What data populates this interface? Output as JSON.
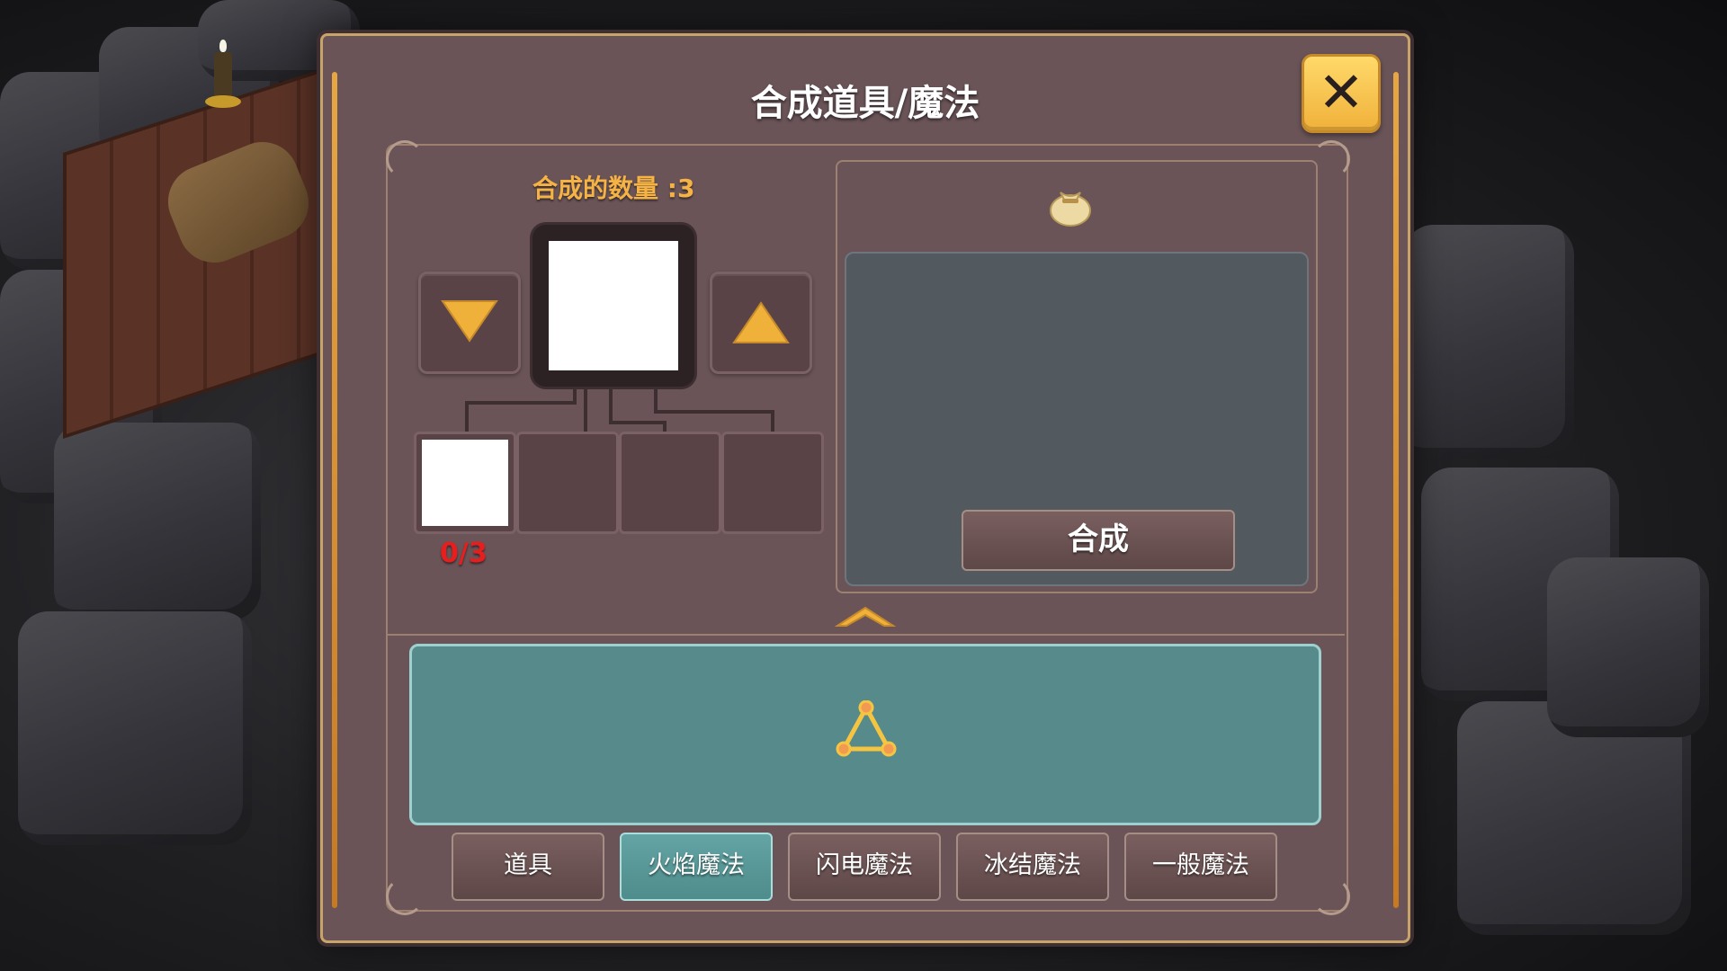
{
  "window": {
    "title": "合成道具/魔法",
    "close_icon": "close-icon"
  },
  "craft": {
    "count_label": "合成的数量 :3",
    "decrease_icon": "triangle-down-icon",
    "increase_icon": "triangle-up-icon",
    "progress": "0/3",
    "slots_total": 4,
    "slots_filled": 1
  },
  "preview": {
    "bag_icon": "pouch-icon",
    "craft_button": "合成"
  },
  "magic_area": {
    "icon": "triangle-nodes-icon"
  },
  "tabs": [
    {
      "label": "道具",
      "active": false
    },
    {
      "label": "火焰魔法",
      "active": true
    },
    {
      "label": "闪电魔法",
      "active": false
    },
    {
      "label": "冰结魔法",
      "active": false
    },
    {
      "label": "一般魔法",
      "active": false
    }
  ],
  "colors": {
    "accent_gold": "#f5b245",
    "progress_red": "#e81e1e",
    "active_tab": "#64a4a4",
    "panel_bg": "#6a5458"
  }
}
